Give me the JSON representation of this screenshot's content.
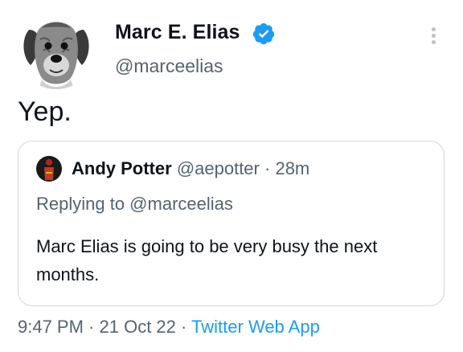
{
  "tweet": {
    "author": {
      "name": "Marc E. Elias",
      "handle": "@marceelias",
      "verified": true,
      "avatar": "dog-portrait-avatar"
    },
    "more_icon": "more-vertical-icon",
    "text": "Yep.",
    "quote": {
      "author_name": "Andy Potter",
      "author_handle": "@aepotter",
      "separator": "·",
      "time": "28m",
      "replying_to": "Replying to @marceelias",
      "text": "Marc Elias is going to be very busy the next months.",
      "avatar": "red-figure-avatar"
    },
    "meta": {
      "time": "9:47 PM",
      "sep1": " · ",
      "date": "21 Oct 22",
      "sep2": " · ",
      "source": "Twitter Web App"
    }
  },
  "colors": {
    "text": "#0f1419",
    "secondary": "#536471",
    "link": "#1d9bf0",
    "verified": "#1d9bf0",
    "border": "#cfd9de"
  }
}
